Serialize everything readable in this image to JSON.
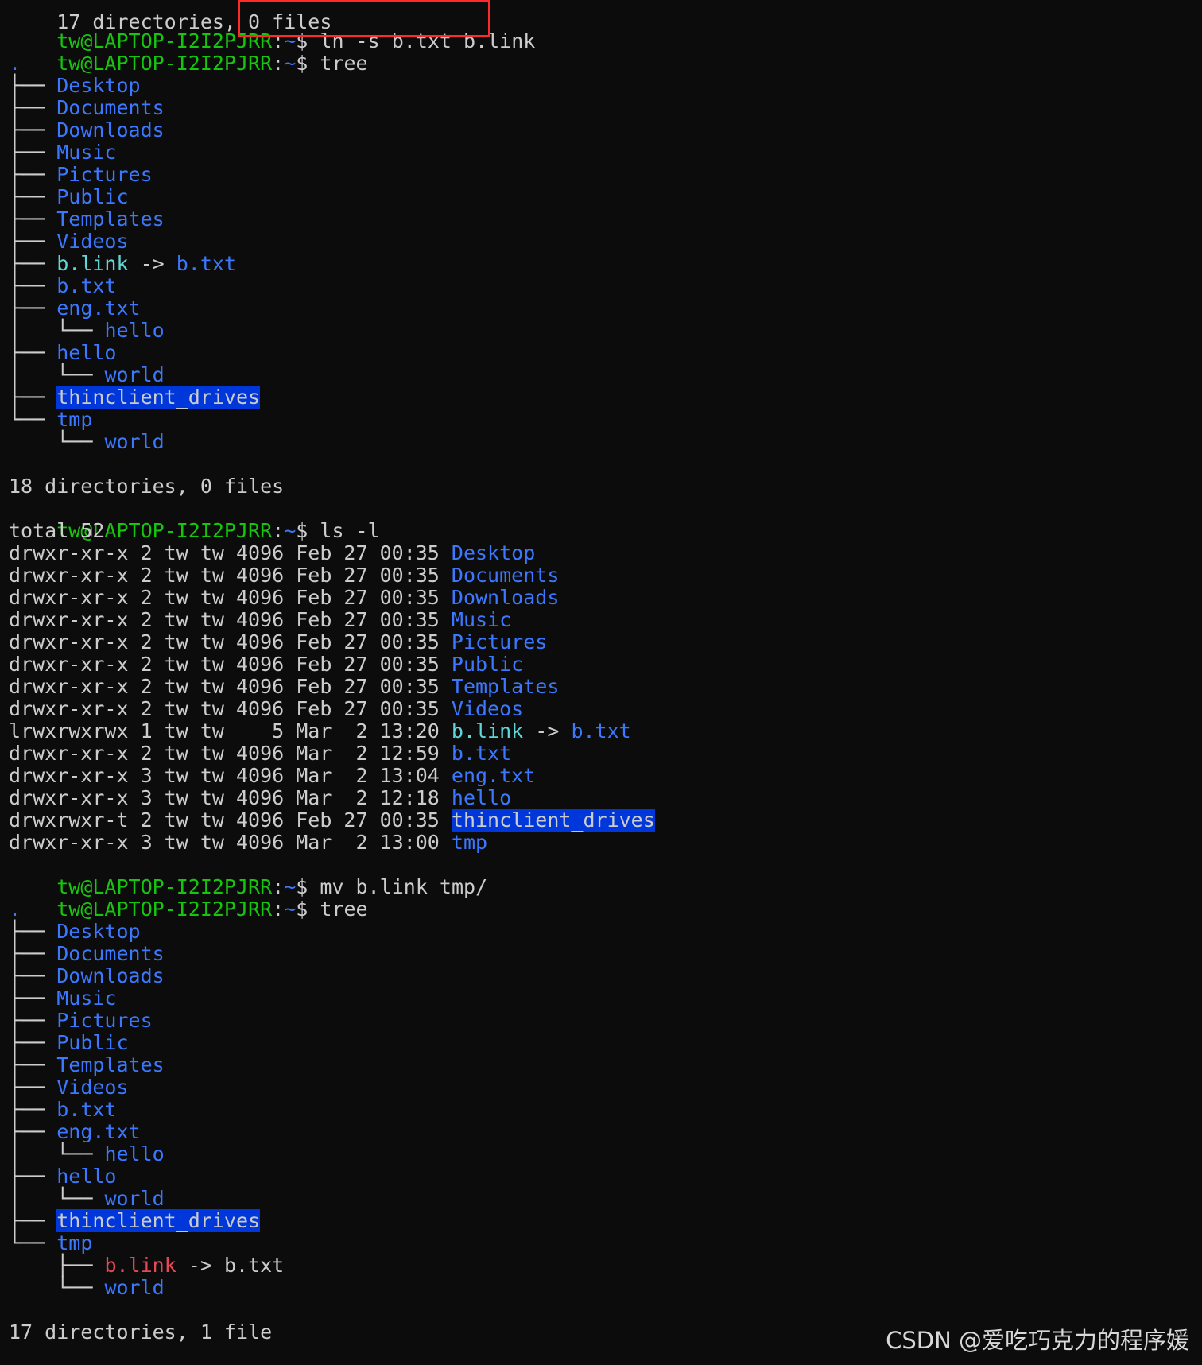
{
  "prompt": {
    "user": "tw@LAPTOP-I2I2PJRR",
    "sep": ":",
    "path": "~",
    "sign": "$"
  },
  "top_partial": "17 directories, 0 files",
  "cmd1": "ln -s b.txt b.link",
  "cmd2": "tree",
  "tree1": {
    "root": ".",
    "branch": "├── ",
    "last": "└── ",
    "pipe": "│   ",
    "items": [
      "Desktop",
      "Documents",
      "Downloads",
      "Music",
      "Pictures",
      "Public",
      "Templates",
      "Videos"
    ],
    "blink": "b.link",
    "arrow": " -> ",
    "target": "b.txt",
    "btxt": "b.txt",
    "engtxt": "eng.txt",
    "hello_child": "hello",
    "hello": "hello",
    "world_child": "world",
    "thin": "thinclient_drives",
    "tmp": "tmp",
    "tmp_child": "world",
    "summary": "18 directories, 0 files"
  },
  "cmd3": "ls -l",
  "ls": {
    "total": "total 52",
    "rows": [
      {
        "meta": "drwxr-xr-x 2 tw tw 4096 Feb 27 00:35 ",
        "name": "Desktop",
        "kind": "dir"
      },
      {
        "meta": "drwxr-xr-x 2 tw tw 4096 Feb 27 00:35 ",
        "name": "Documents",
        "kind": "dir"
      },
      {
        "meta": "drwxr-xr-x 2 tw tw 4096 Feb 27 00:35 ",
        "name": "Downloads",
        "kind": "dir"
      },
      {
        "meta": "drwxr-xr-x 2 tw tw 4096 Feb 27 00:35 ",
        "name": "Music",
        "kind": "dir"
      },
      {
        "meta": "drwxr-xr-x 2 tw tw 4096 Feb 27 00:35 ",
        "name": "Pictures",
        "kind": "dir"
      },
      {
        "meta": "drwxr-xr-x 2 tw tw 4096 Feb 27 00:35 ",
        "name": "Public",
        "kind": "dir"
      },
      {
        "meta": "drwxr-xr-x 2 tw tw 4096 Feb 27 00:35 ",
        "name": "Templates",
        "kind": "dir"
      },
      {
        "meta": "drwxr-xr-x 2 tw tw 4096 Feb 27 00:35 ",
        "name": "Videos",
        "kind": "dir"
      },
      {
        "meta": "lrwxrwxrwx 1 tw tw    5 Mar  2 13:20 ",
        "name": "b.link",
        "kind": "link",
        "arrow": " -> ",
        "target": "b.txt"
      },
      {
        "meta": "drwxr-xr-x 2 tw tw 4096 Mar  2 12:59 ",
        "name": "b.txt",
        "kind": "dir"
      },
      {
        "meta": "drwxr-xr-x 3 tw tw 4096 Mar  2 13:04 ",
        "name": "eng.txt",
        "kind": "dir"
      },
      {
        "meta": "drwxr-xr-x 3 tw tw 4096 Mar  2 12:18 ",
        "name": "hello",
        "kind": "dir"
      },
      {
        "meta": "drwxrwxr-t 2 tw tw 4096 Feb 27 00:35 ",
        "name": "thinclient_drives",
        "kind": "sticky"
      },
      {
        "meta": "drwxr-xr-x 3 tw tw 4096 Mar  2 13:00 ",
        "name": "tmp",
        "kind": "dir"
      }
    ]
  },
  "cmd4": "mv b.link tmp/",
  "cmd5": "tree",
  "tree2": {
    "root": ".",
    "items": [
      "Desktop",
      "Documents",
      "Downloads",
      "Music",
      "Pictures",
      "Public",
      "Templates",
      "Videos"
    ],
    "btxt": "b.txt",
    "engtxt": "eng.txt",
    "hello_child": "hello",
    "hello": "hello",
    "world_child": "world",
    "thin": "thinclient_drives",
    "tmp": "tmp",
    "tmp_link": "b.link",
    "arrow": " -> ",
    "tmp_link_target": "b.txt",
    "tmp_world": "world",
    "summary": "17 directories, 1 file"
  },
  "watermark": "CSDN @爱吃巧克力的程序媛",
  "colors": {
    "background": "#0c0c0c",
    "prompt_user": "#16c60c",
    "prompt_path": "#3b78ff",
    "directory": "#3b78ff",
    "symlink": "#61d6d6",
    "broken_symlink": "#e74856",
    "sticky_highlight": "#0037da",
    "annotation_box": "#ff2a2a"
  }
}
